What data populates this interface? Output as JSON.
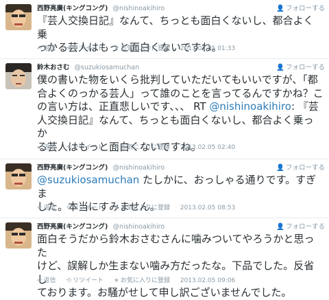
{
  "tweets": [
    {
      "name": "西野亮廣(キングコング)",
      "handle": "@nishinoakihiro",
      "follow": "フォローする",
      "lines": [
        "『芸人交換日記』なんて、ちっとも面白くないし、都合よく乗",
        "っかる芸人はもっと面白くないですね。"
      ],
      "reply": "返信",
      "retweet": "リツイート",
      "favorite": "お気に入りに登録",
      "timestamp": "2013.02.05 01:33"
    },
    {
      "name": "鈴木おさむ",
      "handle": "@suzukiosamuchan",
      "follow": "フォローする",
      "lines": [
        "僕の書いた物をいくら批判していただいてもいいですが、「都",
        "合よくのっかる芸人」って誰のことを言ってるんですかね？こ",
        "の言い方は、正直悲しいです、、、 RT ",
        "人交換日記』なんて、ちっとも面白くないし、都合よく乗っか",
        "る芸人はもっと面白くないですね。"
      ],
      "line3_mention": "@nishinoakihiro",
      "line3_tail": ": 『芸",
      "reply": "返信",
      "retweet": "リツイート",
      "favorite": "お気に入りに登録",
      "timestamp": "2013.02.05 02:40"
    },
    {
      "name": "西野亮廣(キングコング)",
      "handle": "@nishinoakihiro",
      "follow": "フォローする",
      "mention": "@suzukiosamuchan",
      "lines": [
        " たしかに、おっしゃる通りです。すぎま",
        "した。本当にすみません。"
      ],
      "reply": "返信",
      "retweet": "リツイート",
      "favorite": "お気に入りに登録",
      "timestamp": "2013.02.05 08:53"
    },
    {
      "name": "西野亮廣(キングコング)",
      "handle": "@nishinoakihiro",
      "follow": "フォローする",
      "lines": [
        "面白そうだから鈴木おさむさんに噛みついてやろうかと思った",
        "けど、誤解しか生まない噛み方だったな。下品でした。反省し",
        "ております。お騒がせして申し訳ございませんでした。"
      ],
      "reply": "返信",
      "retweet": "リツイート",
      "favorite": "お気に入りに登録",
      "timestamp": "2013.02.05 09:06"
    }
  ],
  "icons": {
    "reply": "reply-arrow-icon",
    "retweet": "retweet-icon",
    "favorite": "star-icon",
    "follow": "follow-person-icon"
  },
  "colors": {
    "text": "#292f33",
    "meta": "#8899a6",
    "link": "#2b7bb9",
    "divider": "#e6ecf0"
  }
}
